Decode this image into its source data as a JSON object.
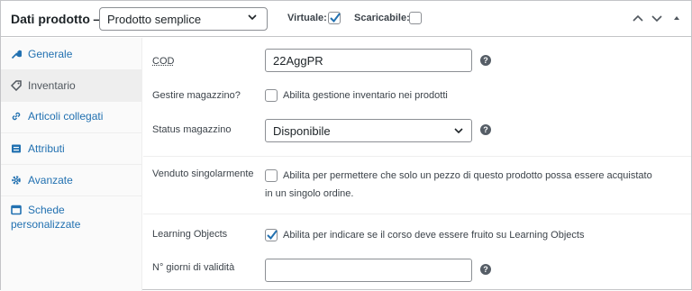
{
  "header": {
    "title": "Dati prodotto —",
    "product_type": "Prodotto semplice",
    "virtual_label": "Virtuale:",
    "virtual_checked": true,
    "downloadable_label": "Scaricabile:",
    "downloadable_checked": false,
    "icons": [
      "chevron-up-icon",
      "chevron-down-icon",
      "triangle-up-icon"
    ]
  },
  "sidebar": {
    "tabs": [
      {
        "label": "Generale",
        "icon": "wrench-icon",
        "active": false
      },
      {
        "label": "Inventario",
        "icon": "tag-icon",
        "active": true
      },
      {
        "label": "Articoli collegati",
        "icon": "link-icon",
        "active": false
      },
      {
        "label": "Attributi",
        "icon": "list-icon",
        "active": false
      },
      {
        "label": "Avanzate",
        "icon": "gear-icon",
        "active": false
      },
      {
        "label_line1": "Schede",
        "label_line2": "personalizzate",
        "icon": "table-icon",
        "active": false
      }
    ]
  },
  "fields": {
    "sku": {
      "label": "COD",
      "value": "22AggPR"
    },
    "manage_stock": {
      "label": "Gestire magazzino?",
      "checkbox_text": "Abilita gestione inventario nei prodotti",
      "checked": false
    },
    "stock_status": {
      "label": "Status magazzino",
      "value": "Disponibile"
    },
    "sold_individually": {
      "label": "Venduto singolarmente",
      "checkbox_text_line1": "Abilita per permettere che solo un pezzo di questo prodotto possa essere acquistato",
      "checkbox_text_line2": "in un singolo ordine.",
      "checked": false
    },
    "learning_objects": {
      "label": "Learning Objects",
      "checkbox_text": "Abilita per indicare se il corso deve essere fruito su Learning Objects",
      "checked": true
    },
    "validity_days": {
      "label": "N° giorni di validità",
      "value": ""
    }
  },
  "colors": {
    "accent": "#2271b1",
    "border": "#8c8f94",
    "active_tab_bg": "#eeeeee",
    "help_icon": "#555d66"
  }
}
